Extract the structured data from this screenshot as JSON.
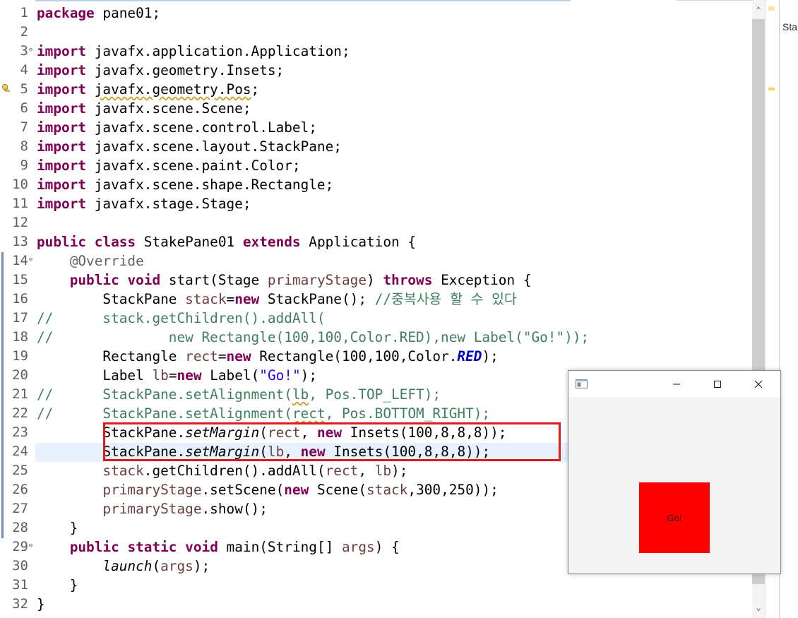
{
  "editor": {
    "lines": [
      {
        "n": "1",
        "tokens": [
          {
            "c": "kw",
            "t": "package"
          },
          {
            "c": "",
            "t": " pane01;"
          }
        ]
      },
      {
        "n": "2",
        "tokens": []
      },
      {
        "n": "3",
        "fold": "⊖",
        "tokens": [
          {
            "c": "kw",
            "t": "import"
          },
          {
            "c": "",
            "t": " javafx.application.Application;"
          }
        ]
      },
      {
        "n": "4",
        "tokens": [
          {
            "c": "kw",
            "t": "import"
          },
          {
            "c": "",
            "t": " javafx.geometry.Insets;"
          }
        ]
      },
      {
        "n": "5",
        "tokens": [
          {
            "c": "kw",
            "t": "import"
          },
          {
            "c": "",
            "t": " "
          },
          {
            "c": "sq",
            "t": "javafx.geometry.Pos"
          },
          {
            "c": "",
            "t": ";"
          }
        ]
      },
      {
        "n": "6",
        "tokens": [
          {
            "c": "kw",
            "t": "import"
          },
          {
            "c": "",
            "t": " javafx.scene.Scene;"
          }
        ]
      },
      {
        "n": "7",
        "tokens": [
          {
            "c": "kw",
            "t": "import"
          },
          {
            "c": "",
            "t": " javafx.scene.control.Label;"
          }
        ]
      },
      {
        "n": "8",
        "tokens": [
          {
            "c": "kw",
            "t": "import"
          },
          {
            "c": "",
            "t": " javafx.scene.layout.StackPane;"
          }
        ]
      },
      {
        "n": "9",
        "tokens": [
          {
            "c": "kw",
            "t": "import"
          },
          {
            "c": "",
            "t": " javafx.scene.paint.Color;"
          }
        ]
      },
      {
        "n": "10",
        "tokens": [
          {
            "c": "kw",
            "t": "import"
          },
          {
            "c": "",
            "t": " javafx.scene.shape.Rectangle;"
          }
        ]
      },
      {
        "n": "11",
        "tokens": [
          {
            "c": "kw",
            "t": "import"
          },
          {
            "c": "",
            "t": " javafx.stage.Stage;"
          }
        ]
      },
      {
        "n": "12",
        "tokens": []
      },
      {
        "n": "13",
        "tokens": [
          {
            "c": "kw",
            "t": "public"
          },
          {
            "c": "",
            "t": " "
          },
          {
            "c": "kw",
            "t": "class"
          },
          {
            "c": "",
            "t": " StakePane01 "
          },
          {
            "c": "kw",
            "t": "extends"
          },
          {
            "c": "",
            "t": " Application {"
          }
        ]
      },
      {
        "n": "14",
        "fold": "⊖",
        "tokens": [
          {
            "c": "",
            "t": "    "
          },
          {
            "c": "ann",
            "t": "@Override"
          }
        ]
      },
      {
        "n": "15",
        "tokens": [
          {
            "c": "",
            "t": "    "
          },
          {
            "c": "kw",
            "t": "public"
          },
          {
            "c": "",
            "t": " "
          },
          {
            "c": "kw",
            "t": "void"
          },
          {
            "c": "",
            "t": " start(Stage "
          },
          {
            "c": "var",
            "t": "primaryStage"
          },
          {
            "c": "",
            "t": ") "
          },
          {
            "c": "kw",
            "t": "throws"
          },
          {
            "c": "",
            "t": " Exception {"
          }
        ]
      },
      {
        "n": "16",
        "tokens": [
          {
            "c": "",
            "t": "        StackPane "
          },
          {
            "c": "var",
            "t": "stack"
          },
          {
            "c": "",
            "t": "="
          },
          {
            "c": "kw",
            "t": "new"
          },
          {
            "c": "",
            "t": " StackPane(); "
          },
          {
            "c": "cm",
            "t": "//중복사용 할 수 있다"
          }
        ]
      },
      {
        "n": "17",
        "tokens": [
          {
            "c": "cm",
            "t": "//      stack.getChildren().addAll("
          }
        ]
      },
      {
        "n": "18",
        "tokens": [
          {
            "c": "cm",
            "t": "//              new Rectangle(100,100,Color.RED),new Label(\"Go!\"));"
          }
        ]
      },
      {
        "n": "19",
        "tokens": [
          {
            "c": "",
            "t": "        Rectangle "
          },
          {
            "c": "var",
            "t": "rect"
          },
          {
            "c": "",
            "t": "="
          },
          {
            "c": "kw",
            "t": "new"
          },
          {
            "c": "",
            "t": " Rectangle(100,100,Color."
          },
          {
            "c": "const",
            "t": "RED"
          },
          {
            "c": "",
            "t": ");"
          }
        ]
      },
      {
        "n": "20",
        "tokens": [
          {
            "c": "",
            "t": "        Label "
          },
          {
            "c": "var",
            "t": "lb"
          },
          {
            "c": "",
            "t": "="
          },
          {
            "c": "kw",
            "t": "new"
          },
          {
            "c": "",
            "t": " Label("
          },
          {
            "c": "str",
            "t": "\"Go!\""
          },
          {
            "c": "",
            "t": ");"
          }
        ]
      },
      {
        "n": "21",
        "tokens": [
          {
            "c": "cm",
            "t": "//      StackPane.setAlignment("
          },
          {
            "c": "cm sq",
            "t": "lb"
          },
          {
            "c": "cm",
            "t": ", Pos.TOP_LEFT);"
          }
        ]
      },
      {
        "n": "22",
        "tokens": [
          {
            "c": "cm",
            "t": "//      StackPane.setAlignment("
          },
          {
            "c": "cm sq",
            "t": "rect"
          },
          {
            "c": "cm",
            "t": ", Pos.BOTTOM_RIGHT);"
          }
        ]
      },
      {
        "n": "23",
        "tokens": [
          {
            "c": "",
            "t": "        StackPane."
          },
          {
            "c": "it",
            "t": "setMargin"
          },
          {
            "c": "",
            "t": "("
          },
          {
            "c": "var",
            "t": "rect"
          },
          {
            "c": "",
            "t": ", "
          },
          {
            "c": "kw",
            "t": "new"
          },
          {
            "c": "",
            "t": " Insets(100,8,8,8));"
          }
        ]
      },
      {
        "n": "24",
        "tokens": [
          {
            "c": "",
            "t": "        StackPane."
          },
          {
            "c": "it",
            "t": "setMargin"
          },
          {
            "c": "",
            "t": "("
          },
          {
            "c": "var",
            "t": "lb"
          },
          {
            "c": "",
            "t": ", "
          },
          {
            "c": "kw",
            "t": "new"
          },
          {
            "c": "",
            "t": " Insets(100,8,8,8));"
          }
        ]
      },
      {
        "n": "25",
        "tokens": [
          {
            "c": "",
            "t": "        "
          },
          {
            "c": "var",
            "t": "stack"
          },
          {
            "c": "",
            "t": ".getChildren().addAll("
          },
          {
            "c": "var",
            "t": "rect"
          },
          {
            "c": "",
            "t": ", "
          },
          {
            "c": "var",
            "t": "lb"
          },
          {
            "c": "",
            "t": ");"
          }
        ]
      },
      {
        "n": "26",
        "tokens": [
          {
            "c": "",
            "t": "        "
          },
          {
            "c": "var",
            "t": "primaryStage"
          },
          {
            "c": "",
            "t": ".setScene("
          },
          {
            "c": "kw",
            "t": "new"
          },
          {
            "c": "",
            "t": " Scene("
          },
          {
            "c": "var",
            "t": "stack"
          },
          {
            "c": "",
            "t": ",300,250));"
          }
        ]
      },
      {
        "n": "27",
        "tokens": [
          {
            "c": "",
            "t": "        "
          },
          {
            "c": "var",
            "t": "primaryStage"
          },
          {
            "c": "",
            "t": ".show();"
          }
        ]
      },
      {
        "n": "28",
        "tokens": [
          {
            "c": "",
            "t": "    }"
          }
        ]
      },
      {
        "n": "29",
        "fold": "⊖",
        "tokens": [
          {
            "c": "",
            "t": "    "
          },
          {
            "c": "kw",
            "t": "public"
          },
          {
            "c": "",
            "t": " "
          },
          {
            "c": "kw",
            "t": "static"
          },
          {
            "c": "",
            "t": " "
          },
          {
            "c": "kw",
            "t": "void"
          },
          {
            "c": "",
            "t": " main(String[] "
          },
          {
            "c": "var",
            "t": "args"
          },
          {
            "c": "",
            "t": ") {"
          }
        ]
      },
      {
        "n": "30",
        "tokens": [
          {
            "c": "",
            "t": "        "
          },
          {
            "c": "it",
            "t": "launch"
          },
          {
            "c": "",
            "t": "("
          },
          {
            "c": "var",
            "t": "args"
          },
          {
            "c": "",
            "t": ");"
          }
        ]
      },
      {
        "n": "31",
        "tokens": [
          {
            "c": "",
            "t": "    }"
          }
        ]
      },
      {
        "n": "32",
        "tokens": [
          {
            "c": "",
            "t": "}"
          }
        ]
      }
    ]
  },
  "side_panel": {
    "tab_label": "Sta"
  },
  "scrollbar": {
    "up_arrow": "⌃",
    "down_arrow": "⌄"
  },
  "fx_window": {
    "label_text": "Go!",
    "rect_color": "#ff0000",
    "controls": {
      "minimize": "minimize-icon",
      "maximize": "maximize-icon",
      "close": "close-icon"
    }
  }
}
